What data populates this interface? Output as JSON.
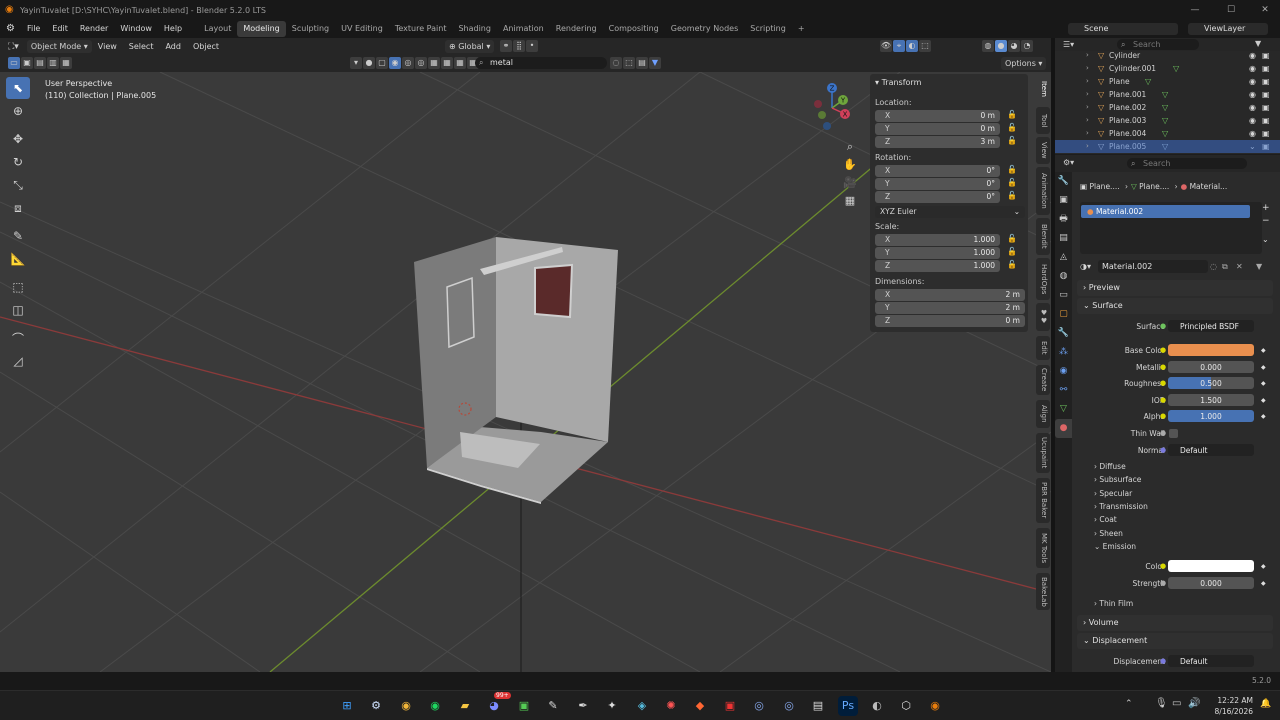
{
  "window": {
    "title": "YayinTuvalet [D:\\SYHC\\YayinTuvalet.blend] - Blender 5.2.0 LTS",
    "min": "—",
    "max": "☐",
    "close": "✕"
  },
  "menu": [
    "File",
    "Edit",
    "Render",
    "Window",
    "Help"
  ],
  "workspaces": [
    "Layout",
    "Modeling",
    "Sculpting",
    "UV Editing",
    "Texture Paint",
    "Shading",
    "Animation",
    "Rendering",
    "Compositing",
    "Geometry Nodes",
    "Scripting"
  ],
  "active_workspace": "Modeling",
  "add_workspace": "+",
  "scene": {
    "label": "Scene",
    "viewlayer": "ViewLayer"
  },
  "viewport_header": {
    "mode": "Object Mode",
    "menus": [
      "View",
      "Select",
      "Add",
      "Object"
    ],
    "orientation": "Global",
    "options": "Options",
    "search_value": "metal"
  },
  "viewport": {
    "perspective": "User Perspective",
    "collection": "(110) Collection | Plane.005"
  },
  "gizmo_axes": {
    "z": "Z",
    "y": "Y",
    "x": "X"
  },
  "npanel": {
    "title": "Transform",
    "location_label": "Location:",
    "location": [
      {
        "k": "X",
        "v": "0 m"
      },
      {
        "k": "Y",
        "v": "0 m"
      },
      {
        "k": "Z",
        "v": "3 m"
      }
    ],
    "rotation_label": "Rotation:",
    "rotation": [
      {
        "k": "X",
        "v": "0°"
      },
      {
        "k": "Y",
        "v": "0°"
      },
      {
        "k": "Z",
        "v": "0°"
      }
    ],
    "rotation_mode": "XYZ Euler",
    "scale_label": "Scale:",
    "scale": [
      {
        "k": "X",
        "v": "1.000"
      },
      {
        "k": "Y",
        "v": "1.000"
      },
      {
        "k": "Z",
        "v": "1.000"
      }
    ],
    "dimensions_label": "Dimensions:",
    "dimensions": [
      {
        "k": "X",
        "v": "2 m"
      },
      {
        "k": "Y",
        "v": "2 m"
      },
      {
        "k": "Z",
        "v": "0 m"
      }
    ]
  },
  "side_tabs": [
    "Item",
    "Tool",
    "View",
    "Animation",
    "Blendit",
    "HardOps",
    "Edit",
    "Create",
    "Align",
    "Ucupaint",
    "PBR Baker",
    "MK Tools",
    "BakeLab"
  ],
  "outliner": {
    "search_placeholder": "Search",
    "rows": [
      {
        "name": "Cylinder"
      },
      {
        "name": "Cylinder.001"
      },
      {
        "name": "Plane"
      },
      {
        "name": "Plane.001"
      },
      {
        "name": "Plane.002"
      },
      {
        "name": "Plane.003"
      },
      {
        "name": "Plane.004"
      },
      {
        "name": "Plane.005"
      }
    ]
  },
  "properties": {
    "search_placeholder": "Search",
    "breadcrumb": [
      "Plane....",
      "Plane....",
      "Material..."
    ],
    "slot": "Material.002",
    "material_name": "Material.002",
    "sections": {
      "preview": "Preview",
      "surface": "Surface",
      "volume": "Volume",
      "displacement": "Displacement"
    },
    "surface_label": "Surface",
    "surface_value": "Principled BSDF",
    "fields": [
      {
        "l": "Base Color",
        "v": "",
        "color": "#e98f4e"
      },
      {
        "l": "Metallic",
        "v": "0.000"
      },
      {
        "l": "Roughness",
        "v": "0.500",
        "fill": 0.5
      },
      {
        "l": "IOR",
        "v": "1.500"
      },
      {
        "l": "Alpha",
        "v": "1.000",
        "fill": 1.0
      },
      {
        "l": "Thin Wall",
        "v": ""
      },
      {
        "l": "Normal",
        "v": "Default"
      }
    ],
    "subpanels": [
      "Diffuse",
      "Subsurface",
      "Specular",
      "Transmission",
      "Coat",
      "Sheen",
      "Emission"
    ],
    "emission_color_label": "Color",
    "emission_color": "#ffffff",
    "emission_strength_label": "Strength",
    "emission_strength": "0.000",
    "thin_film": "Thin Film",
    "displacement_label": "Displacement",
    "displacement_value": "Default"
  },
  "status": {
    "version": "5.2.0"
  },
  "taskbar": {
    "time": "12:22 AM",
    "date": "8/16/2026",
    "badge": "99+"
  }
}
